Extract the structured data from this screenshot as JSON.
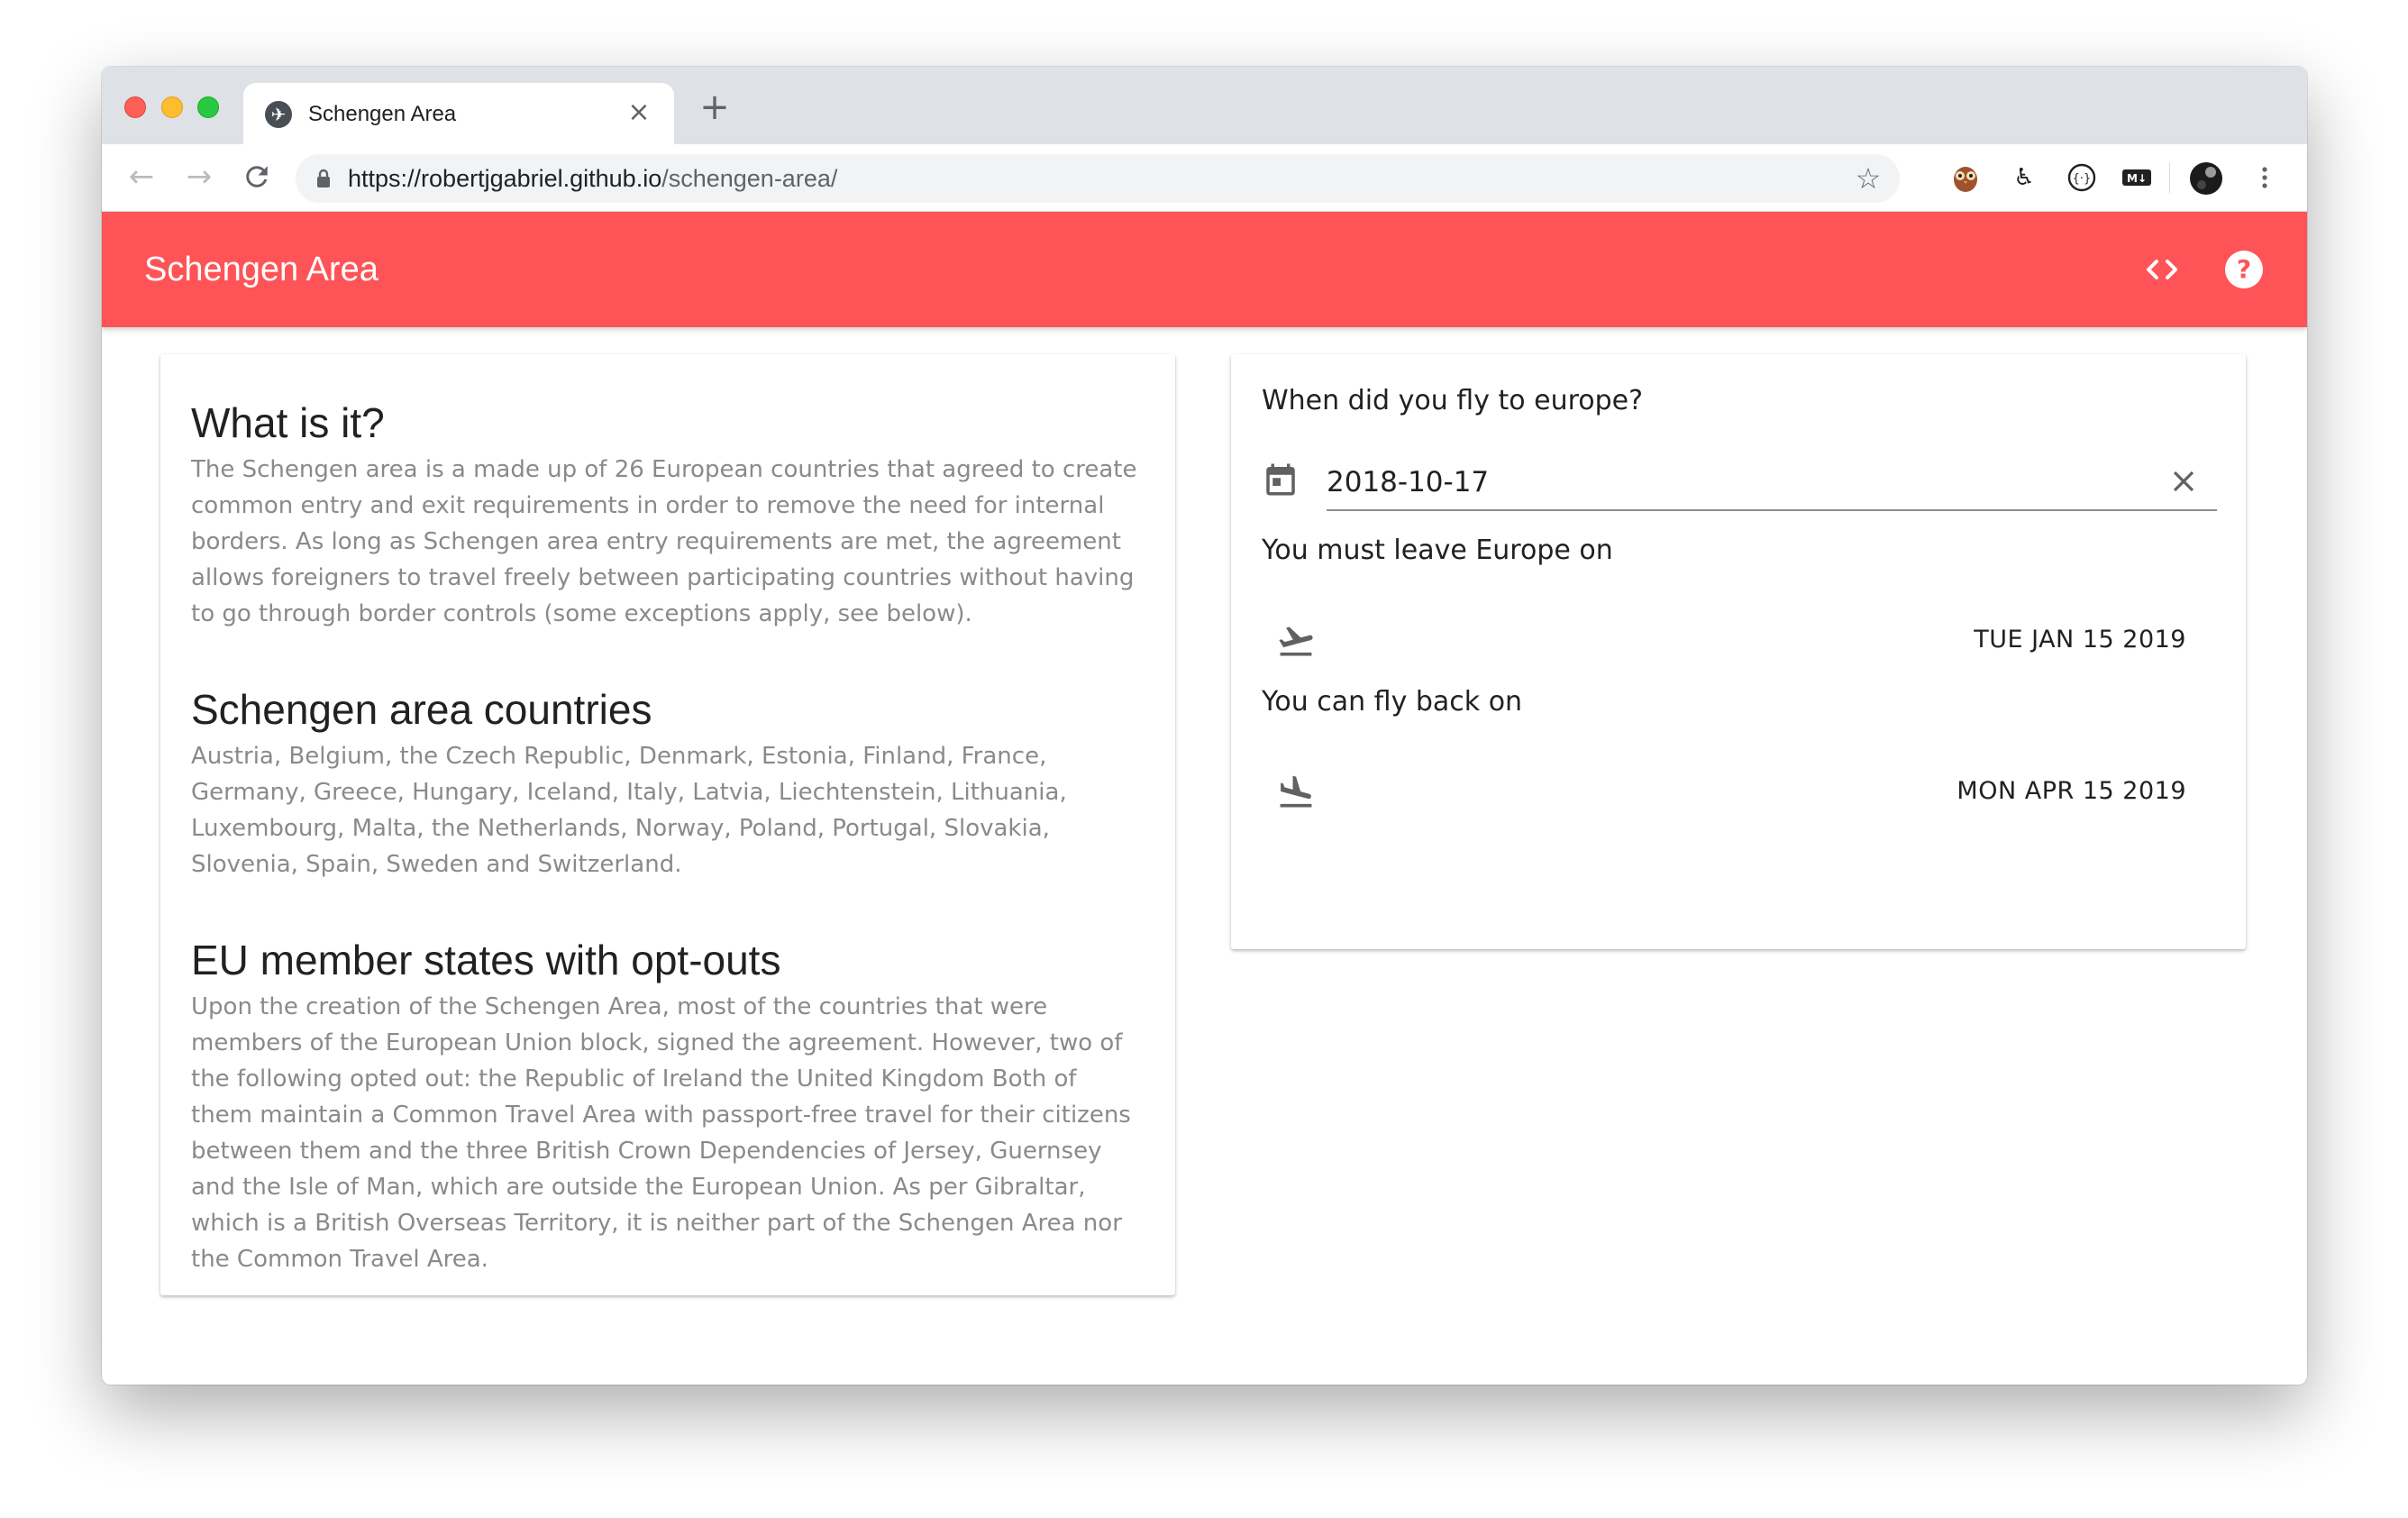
{
  "browser": {
    "tab_title": "Schengen Area",
    "url_host": "https://robertjgabriel.github.io",
    "url_path": "/schengen-area/"
  },
  "app": {
    "title": "Schengen Area",
    "brand_color": "#ff5457"
  },
  "info": {
    "sections": [
      {
        "heading": "What is it?",
        "body": "The Schengen area is a made up of 26 European countries that agreed to create common entry and exit requirements in order to remove the need for internal borders. As long as Schengen area entry requirements are met, the agreement allows foreigners to travel freely between participating countries without having to go through border controls (some exceptions apply, see below)."
      },
      {
        "heading": "Schengen area countries",
        "body": "Austria, Belgium, the Czech Republic, Denmark, Estonia, Finland, France, Germany, Greece, Hungary, Iceland, Italy, Latvia, Liechtenstein, Lithuania, Luxembourg, Malta, the Netherlands, Norway, Poland, Portugal, Slovakia, Slovenia, Spain, Sweden and Switzerland."
      },
      {
        "heading": "EU member states with opt-outs",
        "body": "Upon the creation of the Schengen Area, most of the countries that were members of the European Union block, signed the agreement. However, two of the following opted out: the Republic of Ireland the United Kingdom Both of them maintain a Common Travel Area with passport-free travel for their citizens between them and the three British Crown Dependencies of Jersey, Guernsey and the Isle of Man, which are outside the European Union. As per Gibraltar, which is a British Overseas Territory, it is neither part of the Schengen Area nor the Common Travel Area."
      }
    ]
  },
  "calculator": {
    "question": "When did you fly to europe?",
    "date_value": "2018-10-17",
    "leave_label": "You must leave Europe on",
    "leave_date": "TUE JAN 15 2019",
    "return_label": "You can fly back on",
    "return_date": "MON APR 15 2019"
  }
}
